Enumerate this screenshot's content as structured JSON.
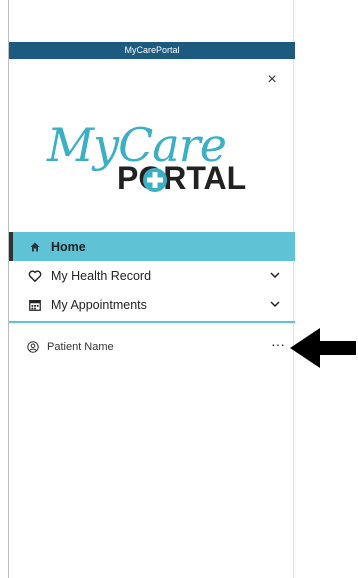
{
  "window": {
    "title": "MyCarePortal"
  },
  "logo": {
    "line1": "MyCare",
    "line2": "PORTAL"
  },
  "icons": {
    "settings": "gear-icon",
    "close": "close-icon",
    "home": "home-icon",
    "health": "heart-icon",
    "appointments": "calendar-icon",
    "patient": "user-circle-icon",
    "more": "more-icon",
    "pointer": "arrow-icon"
  },
  "close_symbol": "×",
  "nav": {
    "items": [
      {
        "label": "Home",
        "active": true
      },
      {
        "label": "My Health Record",
        "expandable": true
      },
      {
        "label": "My Appointments",
        "expandable": true
      }
    ]
  },
  "patient": {
    "name": "Patient Name",
    "more": "···"
  },
  "colors": {
    "titlebar": "#1d5a80",
    "accent": "#5fc2d5",
    "logo": "#3bb0c4"
  }
}
